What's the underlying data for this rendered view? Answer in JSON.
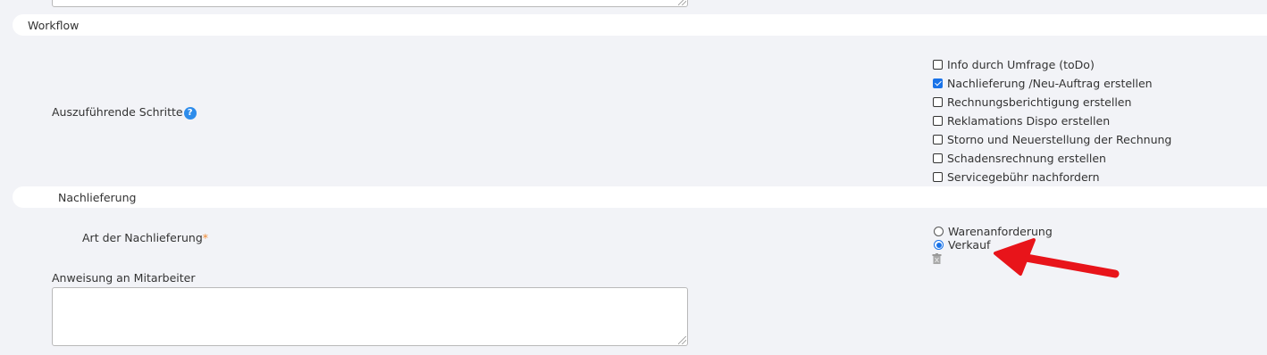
{
  "workflow_section": {
    "title": "Workflow"
  },
  "steps": {
    "label": "Auszuführende Schritte",
    "help_symbol": "?",
    "options": [
      {
        "label": "Info durch Umfrage (toDo)",
        "checked": false
      },
      {
        "label": "Nachlieferung /Neu-Auftrag erstellen",
        "checked": true
      },
      {
        "label": "Rechnungsberichtigung erstellen",
        "checked": false
      },
      {
        "label": "Reklamations Dispo erstellen",
        "checked": false
      },
      {
        "label": "Storno und Neuerstellung der Rechnung",
        "checked": false
      },
      {
        "label": "Schadensrechnung erstellen",
        "checked": false
      },
      {
        "label": "Servicegebühr nachfordern",
        "checked": false
      }
    ]
  },
  "nachlieferung_section": {
    "title": "Nachlieferung"
  },
  "delivery_type": {
    "label": "Art der Nachlieferung",
    "required_marker": "*",
    "options": [
      {
        "label": "Warenanforderung",
        "selected": false
      },
      {
        "label": "Verkauf",
        "selected": true
      }
    ]
  },
  "instructions": {
    "label": "Anweisung an Mitarbeiter",
    "value": ""
  },
  "colors": {
    "accent": "#1a73e8",
    "help": "#2d8ceb",
    "required": "#f08a32",
    "annotation_arrow": "#e8141a"
  },
  "icons": {
    "delete": "trash-icon",
    "help": "help-icon"
  }
}
